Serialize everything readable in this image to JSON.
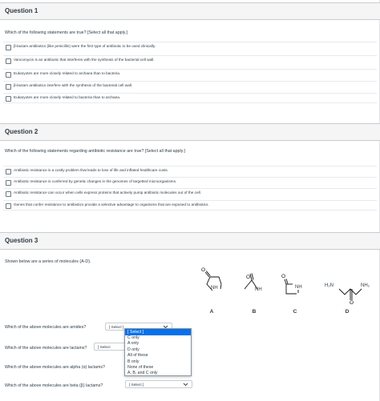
{
  "q1": {
    "title": "Question 1",
    "prompt": "Which of the following statements are true? [Select all that apply.]",
    "answers": [
      "β-lactam antibiotics (like penicillin) were the first type of antibiotic to be used clinically.",
      "Vancomycin is an antibiotic that interferes with the synthesis of the bacterial cell wall.",
      "Eukaryotes are more closely related to archaea than to bacteria.",
      "β-lactam antibiotics interfere with the synthesis of the bacterial cell wall.",
      "Eukaryotes are more closely related to bacteria than to archaea."
    ]
  },
  "q2": {
    "title": "Question 2",
    "prompt": "Which of the following statements regarding antibiotic resistance are true? [Select all that apply.]",
    "answers": [
      "Antibiotic resistance is a costly problem that leads to loss of life and inflated healthcare costs.",
      "Antibiotic resistance is conferred by genetic changes in the genomes of targetted microorganisms.",
      "Antibiotic resistance can occur when cells express proteins that actively pump antibiotic molecules out of the cell.",
      "Genes that confer resistance to antibiotics provide a selective advantage to organisms that are exposed to antibiotics."
    ]
  },
  "q3": {
    "title": "Question 3",
    "prompt": "Shown below are a series of molecules (A-D).",
    "molecules": {
      "labels": [
        "A",
        "B",
        "C",
        "D"
      ],
      "nh": "NH",
      "h2n": "H₂N",
      "nh2": "NH₂"
    },
    "subquestions": [
      {
        "text": "Which of the above molecules are amides?",
        "value": "[ Select ]"
      },
      {
        "text": "Which of the above molecules are lactams?",
        "value": "[ Select"
      },
      {
        "text": "Which of the above molecules are alpha (α) lactams?",
        "value": ""
      },
      {
        "text": "Which of the above molecules are beta (β) lactams?",
        "value": "[ Select ]"
      }
    ],
    "dropdown_options": [
      "[ Select ]",
      "C only",
      "A only",
      "D only",
      "All of these",
      "B only",
      "None of these",
      "A, B, and C only"
    ],
    "dropdown_selected": 0
  },
  "colors": {
    "header_bg": "#f5f5f5",
    "text": "#2d3b45",
    "highlight": "#0770ea"
  }
}
